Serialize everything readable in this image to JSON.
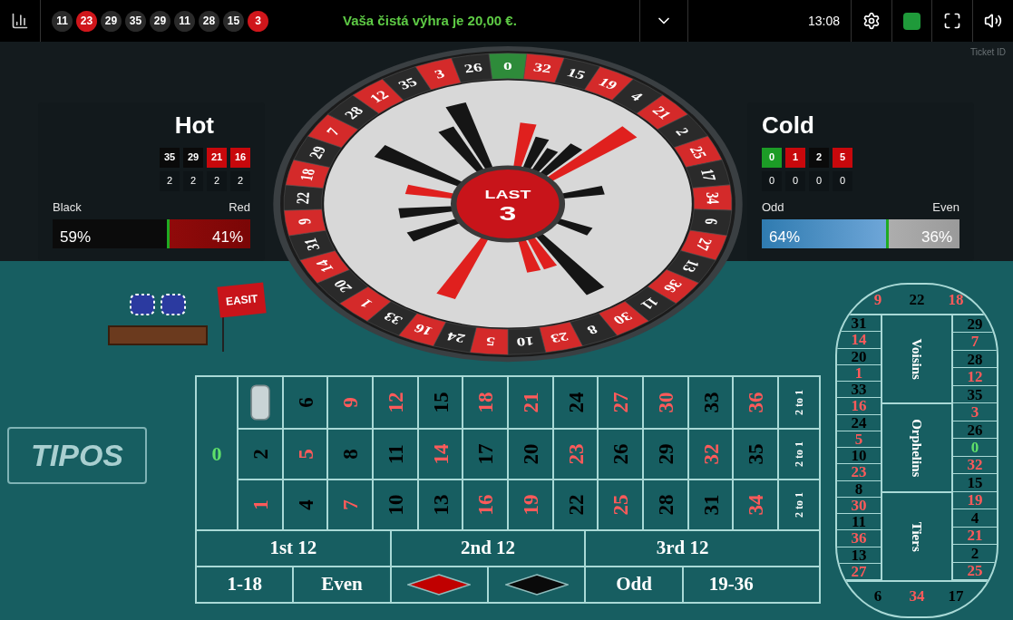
{
  "top_bar": {
    "history": [
      {
        "label": "11",
        "color": "#2a2a2a"
      },
      {
        "label": "23",
        "color": "#d0161b"
      },
      {
        "label": "29",
        "color": "#2a2a2a"
      },
      {
        "label": "35",
        "color": "#2a2a2a"
      },
      {
        "label": "29",
        "color": "#2a2a2a"
      },
      {
        "label": "11",
        "color": "#2a2a2a"
      },
      {
        "label": "28",
        "color": "#2a2a2a"
      },
      {
        "label": "15",
        "color": "#2a2a2a"
      },
      {
        "label": "3",
        "color": "#d0161b"
      }
    ],
    "message": "Vaša čistá výhra je 20,00 €.",
    "time": "13:08"
  },
  "ticket_label": "Ticket ID",
  "hot": {
    "title": "Hot",
    "numbers": [
      {
        "label": "35",
        "color": "#0a0a0a"
      },
      {
        "label": "29",
        "color": "#0a0a0a"
      },
      {
        "label": "21",
        "color": "#c8080c"
      },
      {
        "label": "16",
        "color": "#c8080c"
      }
    ],
    "counts": [
      "2",
      "2",
      "2",
      "2"
    ],
    "left_label": "Black",
    "right_label": "Red",
    "left_value": "59%",
    "right_value": "41%",
    "level": 0.59
  },
  "cold": {
    "title": "Cold",
    "numbers": [
      {
        "label": "0",
        "color": "#1c9c26"
      },
      {
        "label": "1",
        "color": "#c8080c"
      },
      {
        "label": "2",
        "color": "#0a0a0a"
      },
      {
        "label": "5",
        "color": "#c8080c"
      }
    ],
    "counts": [
      "0",
      "0",
      "0",
      "0"
    ],
    "left_label": "Odd",
    "right_label": "Even",
    "left_value": "64%",
    "right_value": "36%",
    "level": 0.64
  },
  "wheel": {
    "last_label": "LAST",
    "last_number": "3",
    "pockets": [
      {
        "label": "0",
        "color": "#2e8b3a"
      },
      {
        "label": "32",
        "color": "#d42a2a"
      },
      {
        "label": "15",
        "color": "#2a2a2a"
      },
      {
        "label": "19",
        "color": "#d42a2a"
      },
      {
        "label": "4",
        "color": "#2a2a2a"
      },
      {
        "label": "21",
        "color": "#d42a2a"
      },
      {
        "label": "2",
        "color": "#2a2a2a"
      },
      {
        "label": "25",
        "color": "#d42a2a"
      },
      {
        "label": "17",
        "color": "#2a2a2a"
      },
      {
        "label": "34",
        "color": "#d42a2a"
      },
      {
        "label": "6",
        "color": "#2a2a2a"
      },
      {
        "label": "27",
        "color": "#d42a2a"
      },
      {
        "label": "13",
        "color": "#2a2a2a"
      },
      {
        "label": "36",
        "color": "#d42a2a"
      },
      {
        "label": "11",
        "color": "#2a2a2a"
      },
      {
        "label": "30",
        "color": "#d42a2a"
      },
      {
        "label": "8",
        "color": "#2a2a2a"
      },
      {
        "label": "23",
        "color": "#d42a2a"
      },
      {
        "label": "10",
        "color": "#2a2a2a"
      },
      {
        "label": "5",
        "color": "#d42a2a"
      },
      {
        "label": "24",
        "color": "#2a2a2a"
      },
      {
        "label": "16",
        "color": "#d42a2a"
      },
      {
        "label": "33",
        "color": "#2a2a2a"
      },
      {
        "label": "1",
        "color": "#d42a2a"
      },
      {
        "label": "20",
        "color": "#2a2a2a"
      },
      {
        "label": "14",
        "color": "#d42a2a"
      },
      {
        "label": "31",
        "color": "#2a2a2a"
      },
      {
        "label": "9",
        "color": "#d42a2a"
      },
      {
        "label": "22",
        "color": "#2a2a2a"
      },
      {
        "label": "18",
        "color": "#d42a2a"
      },
      {
        "label": "29",
        "color": "#2a2a2a"
      },
      {
        "label": "7",
        "color": "#d42a2a"
      },
      {
        "label": "28",
        "color": "#2a2a2a"
      },
      {
        "label": "12",
        "color": "#d42a2a"
      },
      {
        "label": "35",
        "color": "#2a2a2a"
      },
      {
        "label": "3",
        "color": "#d42a2a"
      },
      {
        "label": "26",
        "color": "#2a2a2a"
      }
    ]
  },
  "flag": "EASIT",
  "logo": "TIPOS",
  "betting_table": {
    "zero": {
      "label": "0",
      "color": "#5fe06a"
    },
    "rows": [
      {
        "column_bet": "2 to 1",
        "cells": [
          {
            "kind": "chip"
          },
          {
            "kind": "number",
            "label": "6",
            "color": "#000000"
          },
          {
            "kind": "number",
            "label": "9",
            "color": "#ff5a5a"
          },
          {
            "kind": "number",
            "label": "12",
            "color": "#ff5a5a"
          },
          {
            "kind": "number",
            "label": "15",
            "color": "#000000"
          },
          {
            "kind": "number",
            "label": "18",
            "color": "#ff5a5a"
          },
          {
            "kind": "number",
            "label": "21",
            "color": "#ff5a5a"
          },
          {
            "kind": "number",
            "label": "24",
            "color": "#000000"
          },
          {
            "kind": "number",
            "label": "27",
            "color": "#ff5a5a"
          },
          {
            "kind": "number",
            "label": "30",
            "color": "#ff5a5a"
          },
          {
            "kind": "number",
            "label": "33",
            "color": "#000000"
          },
          {
            "kind": "number",
            "label": "36",
            "color": "#ff5a5a"
          }
        ]
      },
      {
        "column_bet": "2 to 1",
        "cells": [
          {
            "kind": "number",
            "label": "2",
            "color": "#000000"
          },
          {
            "kind": "number",
            "label": "5",
            "color": "#ff5a5a"
          },
          {
            "kind": "number",
            "label": "8",
            "color": "#000000"
          },
          {
            "kind": "number",
            "label": "11",
            "color": "#000000"
          },
          {
            "kind": "number",
            "label": "14",
            "color": "#ff5a5a"
          },
          {
            "kind": "number",
            "label": "17",
            "color": "#000000"
          },
          {
            "kind": "number",
            "label": "20",
            "color": "#000000"
          },
          {
            "kind": "number",
            "label": "23",
            "color": "#ff5a5a"
          },
          {
            "kind": "number",
            "label": "26",
            "color": "#000000"
          },
          {
            "kind": "number",
            "label": "29",
            "color": "#000000"
          },
          {
            "kind": "number",
            "label": "32",
            "color": "#ff5a5a"
          },
          {
            "kind": "number",
            "label": "35",
            "color": "#000000"
          }
        ]
      },
      {
        "column_bet": "2 to 1",
        "cells": [
          {
            "kind": "number",
            "label": "1",
            "color": "#ff5a5a"
          },
          {
            "kind": "number",
            "label": "4",
            "color": "#000000"
          },
          {
            "kind": "number",
            "label": "7",
            "color": "#ff5a5a"
          },
          {
            "kind": "number",
            "label": "10",
            "color": "#000000"
          },
          {
            "kind": "number",
            "label": "13",
            "color": "#000000"
          },
          {
            "kind": "number",
            "label": "16",
            "color": "#ff5a5a"
          },
          {
            "kind": "number",
            "label": "19",
            "color": "#ff5a5a"
          },
          {
            "kind": "number",
            "label": "22",
            "color": "#000000"
          },
          {
            "kind": "number",
            "label": "25",
            "color": "#ff5a5a"
          },
          {
            "kind": "number",
            "label": "28",
            "color": "#000000"
          },
          {
            "kind": "number",
            "label": "31",
            "color": "#000000"
          },
          {
            "kind": "number",
            "label": "34",
            "color": "#ff5a5a"
          }
        ]
      }
    ],
    "dozens": [
      "1st 12",
      "2nd 12",
      "3rd 12"
    ],
    "outside": [
      {
        "kind": "text",
        "label": "1-18"
      },
      {
        "kind": "text",
        "label": "Even"
      },
      {
        "kind": "diamond",
        "color": "#c00000"
      },
      {
        "kind": "diamond",
        "color": "#0a0a0a"
      },
      {
        "kind": "text",
        "label": "Odd"
      },
      {
        "kind": "text",
        "label": "19-36"
      }
    ]
  },
  "racetrack": {
    "top": [
      {
        "label": "9",
        "color": "#ff5a5a"
      },
      {
        "label": "22",
        "color": "#000000"
      },
      {
        "label": "18",
        "color": "#ff5a5a"
      }
    ],
    "left": [
      {
        "label": "31",
        "color": "#000000"
      },
      {
        "label": "14",
        "color": "#ff5a5a"
      },
      {
        "label": "20",
        "color": "#000000"
      },
      {
        "label": "1",
        "color": "#ff5a5a"
      },
      {
        "label": "33",
        "color": "#000000"
      },
      {
        "label": "16",
        "color": "#ff5a5a"
      },
      {
        "label": "24",
        "color": "#000000"
      },
      {
        "label": "5",
        "color": "#ff5a5a"
      },
      {
        "label": "10",
        "color": "#000000"
      },
      {
        "label": "23",
        "color": "#ff5a5a"
      },
      {
        "label": "8",
        "color": "#000000"
      },
      {
        "label": "30",
        "color": "#ff5a5a"
      },
      {
        "label": "11",
        "color": "#000000"
      },
      {
        "label": "36",
        "color": "#ff5a5a"
      },
      {
        "label": "13",
        "color": "#000000"
      },
      {
        "label": "27",
        "color": "#ff5a5a"
      }
    ],
    "sections": [
      "Voisins",
      "Orphelins",
      "Tiers"
    ],
    "right": [
      {
        "label": "29",
        "color": "#000000"
      },
      {
        "label": "7",
        "color": "#ff5a5a"
      },
      {
        "label": "28",
        "color": "#000000"
      },
      {
        "label": "12",
        "color": "#ff5a5a"
      },
      {
        "label": "35",
        "color": "#000000"
      },
      {
        "label": "3",
        "color": "#ff5a5a"
      },
      {
        "label": "26",
        "color": "#000000"
      },
      {
        "label": "0",
        "color": "#5fe06a"
      },
      {
        "label": "32",
        "color": "#ff5a5a"
      },
      {
        "label": "15",
        "color": "#000000"
      },
      {
        "label": "19",
        "color": "#ff5a5a"
      },
      {
        "label": "4",
        "color": "#000000"
      },
      {
        "label": "21",
        "color": "#ff5a5a"
      },
      {
        "label": "2",
        "color": "#000000"
      },
      {
        "label": "25",
        "color": "#ff5a5a"
      }
    ],
    "bottom": [
      {
        "label": "6",
        "color": "#000000"
      },
      {
        "label": "34",
        "color": "#ff5a5a"
      },
      {
        "label": "17",
        "color": "#000000"
      }
    ]
  }
}
